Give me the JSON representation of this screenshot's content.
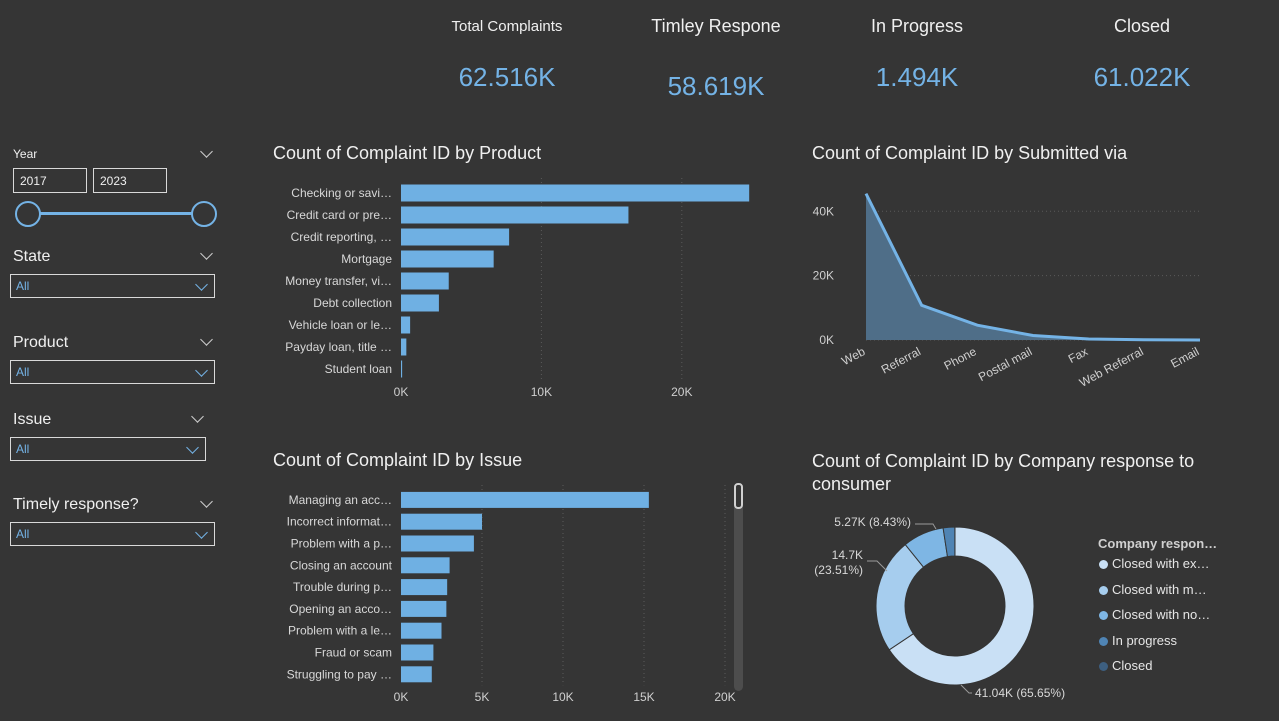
{
  "kpis": [
    {
      "label": "Total Complaints",
      "value": "62.516K"
    },
    {
      "label": "Timley Respone",
      "value": "58.619K"
    },
    {
      "label": "In Progress",
      "value": "1.494K"
    },
    {
      "label": "Closed",
      "value": "61.022K"
    }
  ],
  "slicers": {
    "year": {
      "title": "Year",
      "start": "2017",
      "end": "2023"
    },
    "state": {
      "title": "State",
      "value": "All"
    },
    "product": {
      "title": "Product",
      "value": "All"
    },
    "issue": {
      "title": "Issue",
      "value": "All"
    },
    "timely": {
      "title": "Timely response?",
      "value": "All"
    }
  },
  "colors": {
    "accent": "#74b3e6",
    "bar": "#6fb0e3",
    "area": "#4f6e88"
  },
  "chart_data": [
    {
      "type": "bar",
      "title": "Count of Complaint ID by Product",
      "categories": [
        "Checking or savi…",
        "Credit card or pre…",
        "Credit reporting, …",
        "Mortgage",
        "Money transfer, vi…",
        "Debt collection",
        "Vehicle loan or le…",
        "Payday loan, title …",
        "Student loan"
      ],
      "values": [
        24800,
        16200,
        7700,
        6600,
        3400,
        2700,
        650,
        380,
        80
      ],
      "xlim": [
        0,
        25000
      ],
      "xticks": [
        0,
        10000,
        20000
      ],
      "xtick_labels": [
        "0K",
        "10K",
        "20K"
      ],
      "grid": true
    },
    {
      "type": "area",
      "title": "Count of Complaint ID by Submitted via",
      "categories": [
        "Web",
        "Referral",
        "Phone",
        "Postal mail",
        "Fax",
        "Web Referral",
        "Email"
      ],
      "values": [
        45500,
        10800,
        4600,
        1400,
        300,
        60,
        10
      ],
      "ylim": [
        0,
        46000
      ],
      "yticks": [
        0,
        20000,
        40000
      ],
      "ytick_labels": [
        "0K",
        "20K",
        "40K"
      ],
      "grid": true
    },
    {
      "type": "bar",
      "title": "Count of Complaint ID by Issue",
      "categories": [
        "Managing an acc…",
        "Incorrect informat…",
        "Problem with a p…",
        "Closing an account",
        "Trouble during p…",
        "Opening an acco…",
        "Problem with a le…",
        "Fraud or scam",
        "Struggling to pay …"
      ],
      "values": [
        15300,
        5000,
        4500,
        3000,
        2850,
        2800,
        2500,
        2000,
        1900
      ],
      "xlim": [
        0,
        20000
      ],
      "xticks": [
        0,
        5000,
        10000,
        15000,
        20000
      ],
      "xtick_labels": [
        "0K",
        "5K",
        "10K",
        "15K",
        "20K"
      ],
      "grid": true
    },
    {
      "type": "pie",
      "donut": true,
      "title": "Count of Complaint ID by Company response to consumer",
      "legend_title": "Company respon…",
      "legend_position": "right",
      "series": [
        {
          "name": "Closed with ex…",
          "value": 41040,
          "percent": 65.65,
          "label": "41.04K (65.65%)",
          "color": "#c9e0f5"
        },
        {
          "name": "Closed with m…",
          "value": 14700,
          "percent": 23.51,
          "label": "14.7K (23.51%)",
          "color": "#a6cdee"
        },
        {
          "name": "Closed with no…",
          "value": 5270,
          "percent": 8.43,
          "label": "5.27K (8.43%)",
          "color": "#7eb6e4"
        },
        {
          "name": "In progress",
          "value": 1494,
          "percent": 2.39,
          "label": "",
          "color": "#4f84b4"
        },
        {
          "name": "Closed",
          "value": 10,
          "percent": 0.02,
          "label": "",
          "color": "#3d5f80"
        }
      ]
    }
  ]
}
